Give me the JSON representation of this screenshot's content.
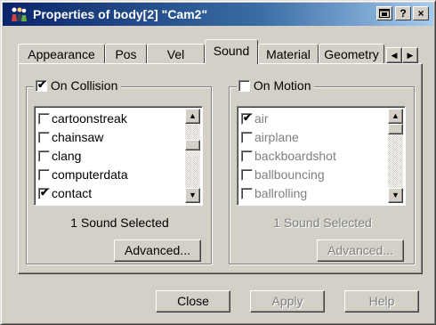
{
  "window": {
    "title": "Properties of body[2] \"Cam2\"",
    "icons": {
      "app": "figures-icon",
      "minimize": "restore-icon",
      "help": "help-icon",
      "close": "close-icon"
    },
    "help_glyph": "?",
    "close_glyph": "×"
  },
  "tabs": [
    {
      "label": "Appearance",
      "active": false
    },
    {
      "label": "Pos",
      "active": false
    },
    {
      "label": "Vel",
      "active": false
    },
    {
      "label": "Sound",
      "active": true
    },
    {
      "label": "Material",
      "active": false
    },
    {
      "label": "Geometry",
      "active": false
    }
  ],
  "tab_scroll": {
    "left": "◀",
    "right": "▶"
  },
  "on_collision": {
    "label": "On Collision",
    "checked": true,
    "items": [
      {
        "label": "cartoonstreak",
        "checked": false
      },
      {
        "label": "chainsaw",
        "checked": false
      },
      {
        "label": "clang",
        "checked": false
      },
      {
        "label": "computerdata",
        "checked": false
      },
      {
        "label": "contact",
        "checked": true
      }
    ],
    "status": "1 Sound Selected",
    "advanced": "Advanced..."
  },
  "on_motion": {
    "label": "On Motion",
    "checked": false,
    "items": [
      {
        "label": "air",
        "checked": true
      },
      {
        "label": "airplane",
        "checked": false
      },
      {
        "label": "backboardshot",
        "checked": false
      },
      {
        "label": "ballbouncing",
        "checked": false
      },
      {
        "label": "ballrolling",
        "checked": false
      }
    ],
    "status": "1 Sound Selected",
    "advanced": "Advanced..."
  },
  "footer": {
    "close": "Close",
    "apply": "Apply",
    "help": "Help"
  },
  "check_glyph": "✔",
  "scroll_up_glyph": "▲",
  "scroll_down_glyph": "▼",
  "colors": {
    "title_start": "#0a246a",
    "title_end": "#a6caf0",
    "face": "#d4d0c8",
    "disabled": "#808080"
  }
}
